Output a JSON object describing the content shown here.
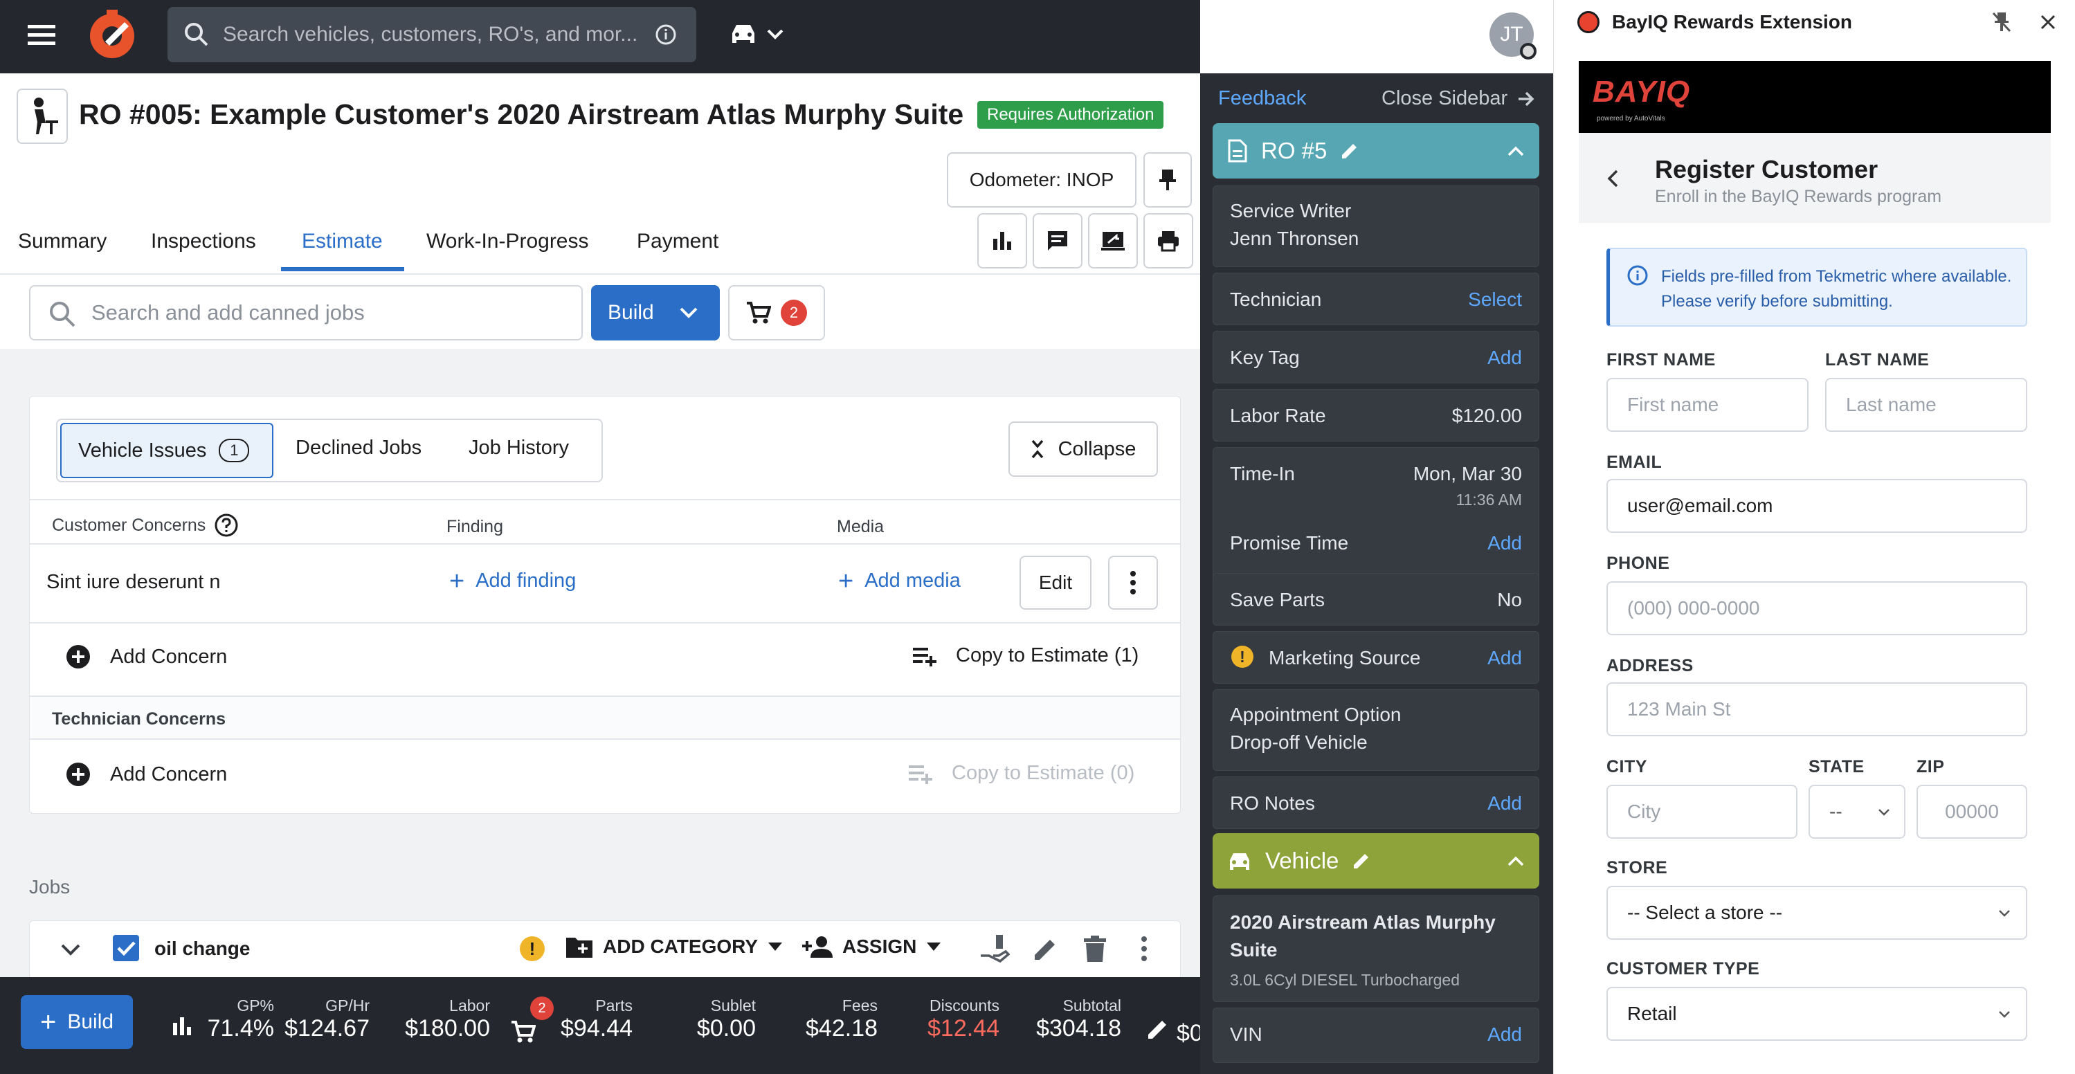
{
  "topbar": {
    "search_placeholder": "Search vehicles, customers, RO's, and mor...",
    "avatar_initials": "JT"
  },
  "ro": {
    "title": "RO #005: Example Customer's 2020 Airstream Atlas Murphy Suite",
    "status_badge": "Requires Authorization",
    "odometer": "Odometer: INOP"
  },
  "tabs": [
    "Summary",
    "Inspections",
    "Estimate",
    "Work-In-Progress",
    "Payment"
  ],
  "active_tab": "Estimate",
  "toolbar": {
    "canned_placeholder": "Search and add canned jobs",
    "build_label": "Build",
    "cart_count": "2"
  },
  "issues": {
    "seg_vehicle_issues": "Vehicle Issues",
    "seg_vehicle_issues_count": "1",
    "seg_declined": "Declined Jobs",
    "seg_history": "Job History",
    "collapse_label": "Collapse",
    "col_customer_concerns": "Customer Concerns",
    "col_finding": "Finding",
    "col_media": "Media",
    "concern_text": "Sint iure deserunt n",
    "add_finding": "Add finding",
    "add_media": "Add media",
    "edit_label": "Edit",
    "add_concern": "Add Concern",
    "copy_to_estimate_1": "Copy to Estimate (1)",
    "technician_concerns": "Technician Concerns",
    "add_concern_2": "Add Concern",
    "copy_to_estimate_0": "Copy to Estimate (0)"
  },
  "jobs": {
    "section_label": "Jobs",
    "job_name": "oil change",
    "add_category": "ADD CATEGORY",
    "assign": "ASSIGN"
  },
  "bottom": {
    "build_label": "Build",
    "cart_count": "2",
    "stats": [
      {
        "label": "GP%",
        "value": "71.4%"
      },
      {
        "label": "GP/Hr",
        "value": "$124.67"
      },
      {
        "label": "Labor",
        "value": "$180.00"
      },
      {
        "label": "Parts",
        "value": "$94.44"
      },
      {
        "label": "Sublet",
        "value": "$0.00"
      },
      {
        "label": "Fees",
        "value": "$42.18"
      },
      {
        "label": "Discounts",
        "value": "$12.44"
      },
      {
        "label": "Subtotal",
        "value": "$304.18"
      }
    ],
    "trailing_value": "$0",
    "discount_color": "#ff6b5e"
  },
  "sidebar": {
    "feedback": "Feedback",
    "close": "Close Sidebar",
    "ro_header": "RO #5",
    "ro_header_color": "#56a7b3",
    "service_writer_label": "Service Writer",
    "service_writer_value": "Jenn  Thronsen",
    "technician_label": "Technician",
    "technician_action": "Select",
    "key_tag_label": "Key Tag",
    "key_tag_action": "Add",
    "labor_rate_label": "Labor Rate",
    "labor_rate_value": "$120.00",
    "time_in_label": "Time-In",
    "time_in_date": "Mon, Mar 30",
    "time_in_time": "11:36 AM",
    "promise_time_label": "Promise Time",
    "promise_time_action": "Add",
    "save_parts_label": "Save Parts",
    "save_parts_value": "No",
    "marketing_source_label": "Marketing Source",
    "marketing_source_action": "Add",
    "appointment_option_label": "Appointment Option",
    "appointment_option_value": "Drop-off Vehicle",
    "ro_notes_label": "RO Notes",
    "ro_notes_action": "Add",
    "vehicle_header": "Vehicle",
    "vehicle_header_color": "#8ea33a",
    "vehicle_name": "2020 Airstream Atlas Murphy Suite",
    "vehicle_engine": "3.0L 6Cyl DIESEL Turbocharged",
    "vin_label": "VIN",
    "vin_action": "Add"
  },
  "extension": {
    "title": "BayIQ Rewards Extension",
    "logo_text": "BAYIQ",
    "logo_sub": "powered by AutoVitals",
    "form_title": "Register Customer",
    "form_subtitle": "Enroll in the BayIQ Rewards program",
    "info_text": "Fields pre-filled from Tekmetric where available. Please verify before submitting.",
    "first_name_label": "FIRST NAME",
    "first_name_placeholder": "First name",
    "last_name_label": "LAST NAME",
    "last_name_placeholder": "Last name",
    "email_label": "EMAIL",
    "email_value": "user@email.com",
    "phone_label": "PHONE",
    "phone_placeholder": "(000) 000-0000",
    "address_label": "ADDRESS",
    "address_placeholder": "123 Main St",
    "city_label": "CITY",
    "city_placeholder": "City",
    "state_label": "STATE",
    "state_value": "--",
    "zip_label": "ZIP",
    "zip_placeholder": "00000",
    "store_label": "STORE",
    "store_value": "-- Select a store --",
    "customer_type_label": "CUSTOMER TYPE",
    "customer_type_value": "Retail"
  }
}
